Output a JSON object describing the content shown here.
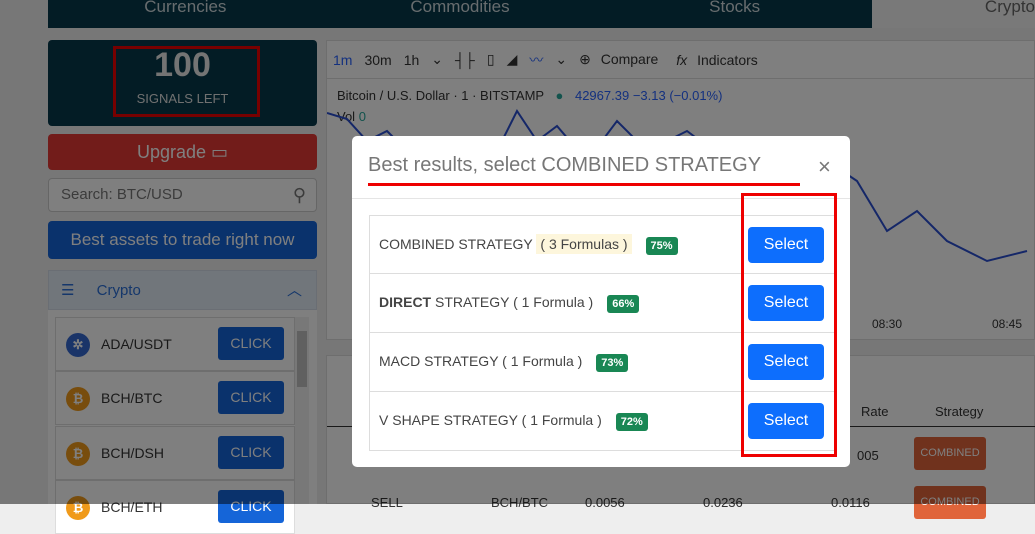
{
  "nav": {
    "tabs": [
      "Currencies",
      "Commodities",
      "Stocks"
    ],
    "active_tab": "Crypto"
  },
  "signals": {
    "count": "100",
    "label": "SIGNALS LEFT"
  },
  "upgrade": {
    "label": "Upgrade"
  },
  "search": {
    "placeholder": "Search: BTC/USD"
  },
  "best_assets": {
    "label": "Best assets to trade right now"
  },
  "crypto_panel": {
    "title": "Crypto",
    "items": [
      {
        "pair": "ADA/USDT",
        "button": "CLICK"
      },
      {
        "pair": "BCH/BTC",
        "button": "CLICK"
      },
      {
        "pair": "BCH/DSH",
        "button": "CLICK"
      },
      {
        "pair": "BCH/ETH",
        "button": "CLICK"
      }
    ]
  },
  "chart": {
    "intervals": [
      "1m",
      "30m",
      "1h"
    ],
    "compare": "Compare",
    "indicators": "Indicators",
    "symbol": "Bitcoin / U.S. Dollar · 1 · BITSTAMP",
    "price": "42967.39",
    "change": "−3.13 (−0.01%)",
    "vol_label": "Vol",
    "vol_value": "0",
    "times": [
      "08:30",
      "08:45"
    ]
  },
  "signals_table": {
    "headers": {
      "rate": "Rate",
      "strategy": "Strategy"
    },
    "rows": [
      {
        "rate": "005",
        "strategy": "COMBINED"
      },
      {
        "type": "SELL",
        "pair": "BCH/BTC",
        "open": "0.0056",
        "close": "0.0236",
        "rate": "0.0116",
        "strategy": "COMBINED"
      }
    ]
  },
  "modal": {
    "title": "Best results, select COMBINED STRATEGY",
    "close": "×",
    "strategies": [
      {
        "name": "COMBINED STRATEGY",
        "formula": "( 3 Formulas )",
        "percent": "75%",
        "button": "Select"
      },
      {
        "name_bold": "DIRECT",
        "name": " STRATEGY",
        "formula": "( 1 Formula )",
        "percent": "66%",
        "button": "Select"
      },
      {
        "name": "MACD STRATEGY",
        "formula": "( 1 Formula )",
        "percent": "73%",
        "button": "Select"
      },
      {
        "name": "V SHAPE STRATEGY",
        "formula": "( 1 Formula )",
        "percent": "72%",
        "button": "Select"
      }
    ]
  },
  "colors": {
    "nav": "#06394b",
    "upgrade": "#e53935",
    "primary": "#1565d8",
    "select": "#0d6efd",
    "badge": "#198754",
    "combined": "#e0643a",
    "annotation": "#ee0000"
  }
}
